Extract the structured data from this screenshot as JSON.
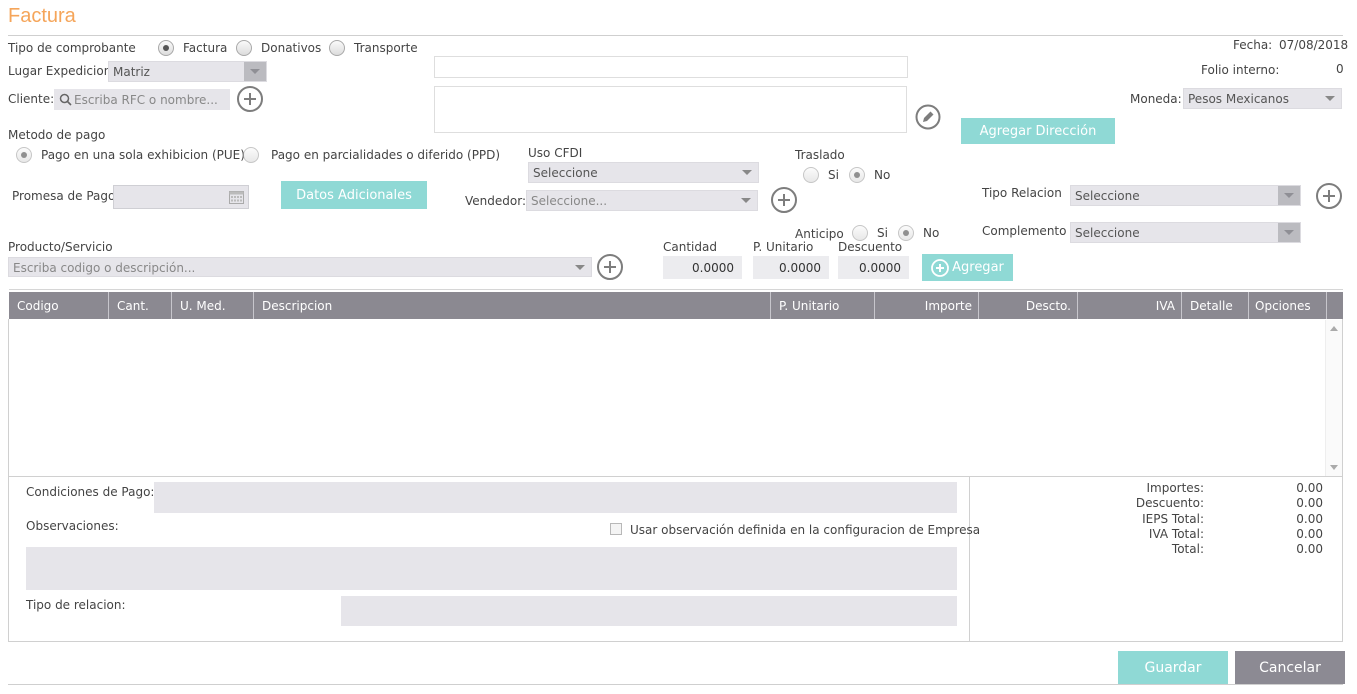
{
  "page": {
    "title": "Factura"
  },
  "comprobante": {
    "label": "Tipo de comprobante",
    "options": [
      "Factura",
      "Donativos",
      "Transporte"
    ],
    "selected": "Factura"
  },
  "fecha": {
    "label": "Fecha:",
    "value": "07/08/2018"
  },
  "folio": {
    "label": "Folio interno:",
    "value": "0"
  },
  "lugar": {
    "label": "Lugar Expedicion",
    "value": "Matriz"
  },
  "cliente": {
    "label": "Cliente:",
    "placeholder": "Escriba RFC o nombre..."
  },
  "moneda": {
    "label": "Moneda:",
    "value": "Pesos Mexicanos"
  },
  "buttons": {
    "agregar_direccion": "Agregar Dirección",
    "datos_adicionales": "Datos Adicionales",
    "agregar": "Agregar",
    "guardar": "Guardar",
    "cancelar": "Cancelar"
  },
  "metodo_pago": {
    "label": "Metodo de pago",
    "options": [
      "Pago en una sola exhibicion (PUE)",
      "Pago en parcialidades o diferido (PPD)"
    ],
    "selected": "Pago en una sola exhibicion (PUE)"
  },
  "uso_cfdi": {
    "label": "Uso CFDI",
    "value": "Seleccione"
  },
  "traslado": {
    "label": "Traslado",
    "options": [
      "Si",
      "No"
    ],
    "selected": "No"
  },
  "promesa": {
    "label": "Promesa de Pago"
  },
  "vendedor": {
    "label": "Vendedor:",
    "value": "Seleccione..."
  },
  "tipo_relacion": {
    "label": "Tipo Relacion",
    "value": "Seleccione"
  },
  "complemento": {
    "label": "Complemento",
    "value": "Seleccione"
  },
  "anticipo": {
    "label": "Anticipo",
    "options": [
      "Si",
      "No"
    ],
    "selected": "No"
  },
  "producto": {
    "label": "Producto/Servicio",
    "placeholder": "Escriba codigo o descripción..."
  },
  "cantidad": {
    "label": "Cantidad",
    "value": "0.0000"
  },
  "p_unitario": {
    "label": "P. Unitario",
    "value": "0.0000"
  },
  "descuento": {
    "label": "Descuento",
    "value": "0.0000"
  },
  "table": {
    "columns": [
      "Codigo",
      "Cant.",
      "U. Med.",
      "Descripcion",
      "P. Unitario",
      "Importe",
      "Descto.",
      "IVA",
      "Detalle",
      "Opciones"
    ],
    "rows": []
  },
  "footer": {
    "condiciones_label": "Condiciones de Pago:",
    "observaciones_label": "Observaciones:",
    "usar_observacion_label": "Usar observación definida en la configuracion de Empresa",
    "tipo_relacion_label": "Tipo de relacion:"
  },
  "totals": [
    {
      "label": "Importes:",
      "value": "0.00"
    },
    {
      "label": "Descuento:",
      "value": "0.00"
    },
    {
      "label": "IEPS Total:",
      "value": "0.00"
    },
    {
      "label": "IVA Total:",
      "value": "0.00"
    },
    {
      "label": "Total:",
      "value": "0.00"
    }
  ],
  "colors": {
    "title": "#f5a55a",
    "accent_button": "#8fd9d5",
    "header_bar": "#8b8991",
    "cancel_button": "#8c8a93",
    "input_gray": "#e6e5ea"
  }
}
